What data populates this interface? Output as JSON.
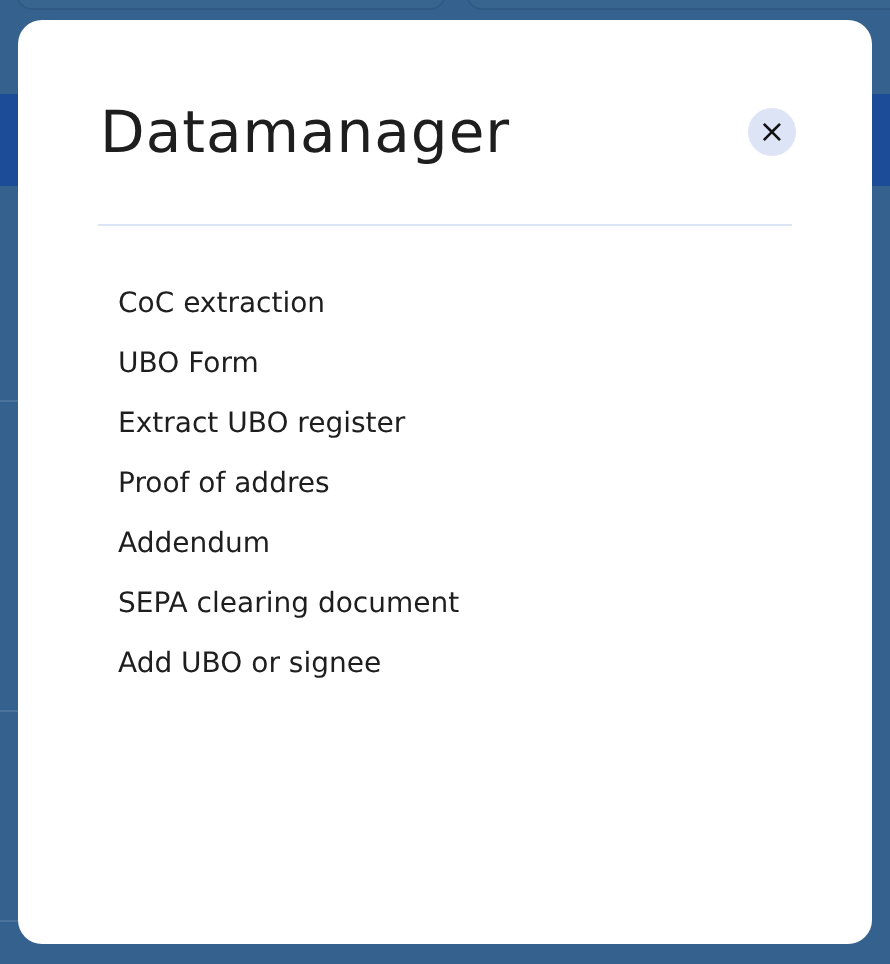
{
  "dialog": {
    "title": "Datamanager",
    "close_label": "×",
    "items": [
      "CoC extraction",
      "UBO Form",
      "Extract UBO register",
      "Proof of addres",
      "Addendum",
      "SEPA clearing document",
      "Add UBO or signee"
    ]
  }
}
